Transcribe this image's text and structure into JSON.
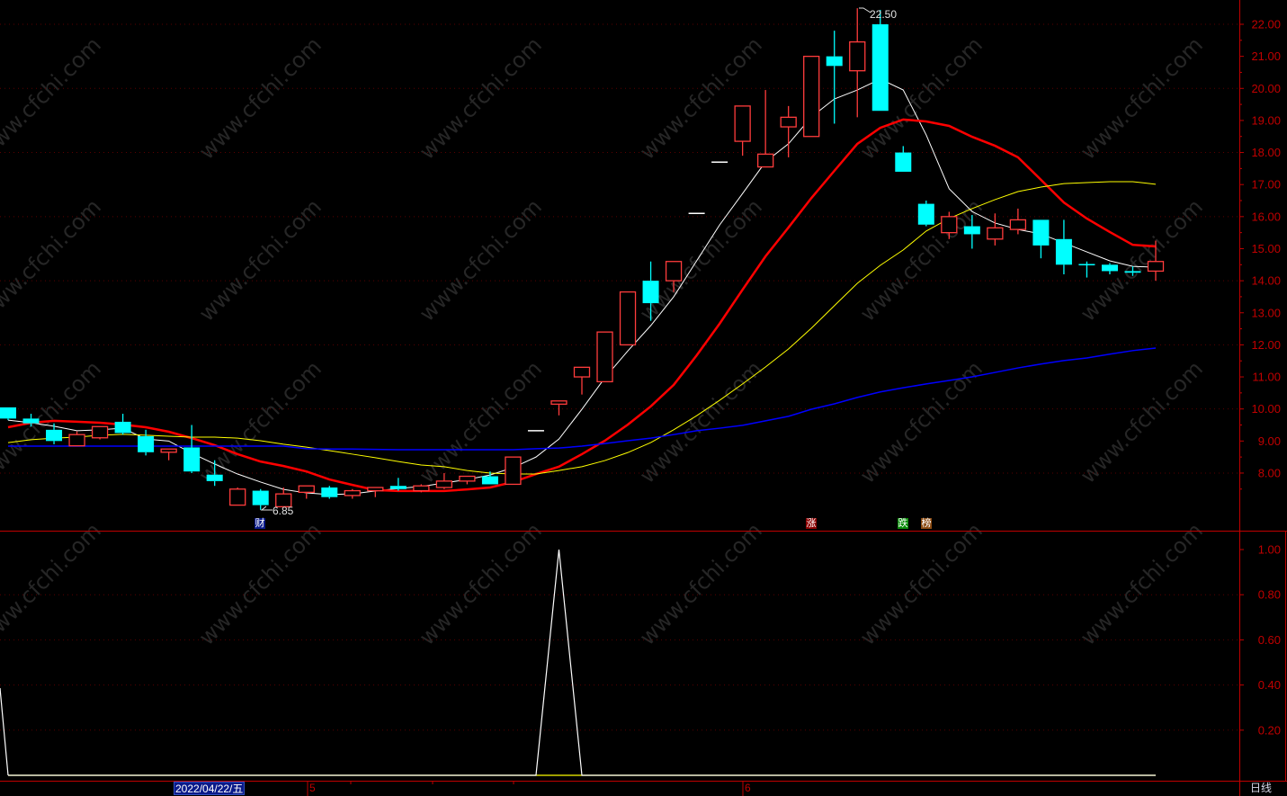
{
  "watermark": "www.cfchi.com",
  "colors": {
    "up": "#ff3c3c",
    "down": "#00ffff",
    "flat": "#ffffff",
    "ma_white": "#ffffff",
    "ma_red": "#ff0000",
    "ma_yellow": "#ffff00",
    "ma_blue": "#0000ff",
    "axis": "#c00000",
    "grid": "#5a0000"
  },
  "markers": [
    {
      "label": "财",
      "bg": "#0a1a8a"
    },
    {
      "label": "涨",
      "bg": "#8b0000"
    },
    {
      "label": "跌",
      "bg": "#0a8a0a"
    },
    {
      "label": "榜",
      "bg": "#8b4a10"
    }
  ],
  "x_axis": {
    "selected_date": "2022/04/22/五",
    "months": [
      "5",
      "6"
    ]
  },
  "period_label": "日线",
  "chart_data": [
    {
      "type": "candlestick",
      "ylim": [
        6.5,
        22.8
      ],
      "y_ticks": [
        "22.00",
        "21.00",
        "20.00",
        "19.00",
        "18.00",
        "17.00",
        "16.00",
        "15.00",
        "14.00",
        "13.00",
        "12.00",
        "11.00",
        "10.00",
        "9.00",
        "8.00"
      ],
      "grid": true,
      "fields": [
        "open",
        "close",
        "high",
        "low"
      ],
      "candles": [
        [
          10.05,
          9.7,
          10.05,
          9.65
        ],
        [
          9.7,
          9.55,
          9.85,
          9.45
        ],
        [
          9.35,
          9.0,
          9.55,
          8.9
        ],
        [
          8.85,
          9.2,
          9.3,
          8.85
        ],
        [
          9.1,
          9.45,
          9.45,
          9.05
        ],
        [
          9.6,
          9.25,
          9.85,
          9.2
        ],
        [
          9.15,
          8.65,
          9.35,
          8.55
        ],
        [
          8.65,
          8.75,
          8.75,
          8.4
        ],
        [
          8.8,
          8.05,
          9.5,
          8.0
        ],
        [
          7.95,
          7.75,
          8.4,
          7.6
        ],
        [
          7.0,
          7.5,
          7.55,
          7.0
        ],
        [
          7.45,
          7.0,
          7.5,
          6.85
        ],
        [
          6.95,
          7.35,
          7.55,
          6.95
        ],
        [
          7.4,
          7.6,
          7.6,
          7.2
        ],
        [
          7.55,
          7.25,
          7.6,
          7.2
        ],
        [
          7.3,
          7.45,
          7.5,
          7.2
        ],
        [
          7.45,
          7.55,
          7.55,
          7.25
        ],
        [
          7.6,
          7.5,
          7.85,
          7.45
        ],
        [
          7.45,
          7.6,
          7.65,
          7.4
        ],
        [
          7.55,
          7.75,
          8.0,
          7.5
        ],
        [
          7.75,
          7.9,
          7.9,
          7.65
        ],
        [
          7.9,
          7.65,
          8.05,
          7.65
        ],
        [
          7.65,
          8.5,
          8.5,
          7.65
        ],
        [
          9.32,
          9.32,
          9.32,
          9.32
        ],
        [
          10.15,
          10.25,
          10.25,
          9.8
        ],
        [
          11.0,
          11.3,
          11.3,
          10.45
        ],
        [
          10.85,
          12.4,
          12.4,
          10.85
        ],
        [
          12.0,
          13.65,
          13.65,
          12.0
        ],
        [
          14.0,
          13.3,
          14.6,
          12.75
        ],
        [
          14.0,
          14.6,
          14.6,
          13.65
        ],
        [
          16.1,
          16.1,
          16.1,
          16.1
        ],
        [
          17.7,
          17.7,
          17.7,
          17.7
        ],
        [
          18.35,
          19.45,
          19.45,
          17.9
        ],
        [
          17.55,
          17.95,
          19.95,
          17.55
        ],
        [
          18.8,
          19.1,
          19.45,
          17.85
        ],
        [
          18.5,
          21.0,
          21.0,
          18.5
        ],
        [
          21.0,
          20.7,
          21.8,
          18.9
        ],
        [
          20.55,
          21.45,
          22.5,
          19.1
        ],
        [
          22.0,
          19.3,
          22.45,
          19.3
        ],
        [
          18.0,
          17.4,
          18.2,
          17.4
        ],
        [
          16.4,
          15.75,
          16.5,
          15.7
        ],
        [
          15.5,
          16.0,
          16.15,
          15.3
        ],
        [
          15.7,
          15.45,
          16.05,
          15.0
        ],
        [
          15.3,
          15.65,
          16.1,
          15.1
        ],
        [
          15.6,
          15.9,
          16.25,
          15.45
        ],
        [
          15.9,
          15.1,
          15.9,
          14.7
        ],
        [
          15.3,
          14.5,
          15.9,
          14.2
        ],
        [
          14.5,
          14.5,
          14.6,
          14.1
        ],
        [
          14.5,
          14.3,
          14.55,
          14.2
        ],
        [
          14.3,
          14.25,
          14.45,
          14.15
        ],
        [
          14.3,
          14.6,
          15.25,
          14.0
        ]
      ],
      "moving_averages": [
        {
          "color": "#ffffff",
          "values": [
            9.65,
            9.57,
            9.46,
            9.32,
            9.35,
            9.4,
            9.06,
            9.0,
            8.62,
            8.28,
            7.97,
            7.72,
            7.49,
            7.38,
            7.33,
            7.35,
            7.44,
            7.52,
            7.58,
            7.69,
            7.8,
            7.94,
            8.17,
            8.5,
            9.06,
            9.99,
            10.97,
            11.81,
            12.6,
            13.5,
            14.62,
            15.74,
            16.72,
            17.71,
            18.27,
            19.11,
            19.67,
            19.95,
            20.29,
            19.95,
            18.55,
            16.87,
            16.16,
            15.8,
            15.6,
            15.46,
            15.18,
            14.9,
            14.62,
            14.45,
            14.42
          ]
        },
        {
          "color": "#ff0000",
          "values": [
            9.43,
            9.57,
            9.63,
            9.6,
            9.57,
            9.51,
            9.43,
            9.29,
            9.09,
            8.87,
            8.59,
            8.36,
            8.22,
            8.05,
            7.8,
            7.63,
            7.47,
            7.44,
            7.44,
            7.44,
            7.49,
            7.55,
            7.72,
            7.97,
            8.2,
            8.59,
            9.01,
            9.51,
            10.08,
            10.75,
            11.67,
            12.66,
            13.72,
            14.76,
            15.66,
            16.58,
            17.43,
            18.27,
            18.77,
            19.03,
            18.97,
            18.83,
            18.49,
            18.21,
            17.85,
            17.15,
            16.44,
            15.94,
            15.52,
            15.12,
            15.07
          ]
        },
        {
          "color": "#ffff00",
          "values": [
            8.95,
            9.04,
            9.09,
            9.12,
            9.18,
            9.21,
            9.18,
            9.15,
            9.12,
            9.12,
            9.09,
            9.01,
            8.9,
            8.81,
            8.7,
            8.59,
            8.48,
            8.36,
            8.25,
            8.2,
            8.08,
            8.0,
            7.97,
            7.97,
            8.08,
            8.2,
            8.39,
            8.64,
            8.95,
            9.35,
            9.79,
            10.27,
            10.78,
            11.31,
            11.87,
            12.52,
            13.22,
            13.92,
            14.48,
            14.96,
            15.55,
            15.94,
            16.25,
            16.53,
            16.78,
            16.92,
            17.03,
            17.06,
            17.09,
            17.09,
            17.01
          ]
        },
        {
          "color": "#0000ff",
          "values": [
            8.84,
            8.84,
            8.84,
            8.84,
            8.84,
            8.84,
            8.84,
            8.84,
            8.84,
            8.84,
            8.84,
            8.84,
            8.84,
            8.76,
            8.75,
            8.75,
            8.74,
            8.73,
            8.73,
            8.73,
            8.73,
            8.73,
            8.73,
            8.76,
            8.78,
            8.84,
            8.92,
            9.01,
            9.09,
            9.2,
            9.32,
            9.4,
            9.49,
            9.63,
            9.77,
            9.99,
            10.16,
            10.36,
            10.53,
            10.66,
            10.78,
            10.89,
            11.0,
            11.14,
            11.28,
            11.4,
            11.51,
            11.59,
            11.71,
            11.82,
            11.9
          ]
        }
      ],
      "annotations": {
        "high_label": "22.50",
        "low_label": "6.85"
      }
    },
    {
      "type": "line",
      "ylim": [
        0,
        1.1
      ],
      "y_ticks": [
        "1.00",
        "0.80",
        "0.60",
        "0.40",
        "0.20"
      ],
      "grid": true,
      "series": [
        {
          "color": "#ffffff",
          "values": [
            0,
            0,
            0,
            0,
            0,
            0,
            0,
            0,
            0,
            0,
            0,
            0,
            0,
            0,
            0,
            0,
            0,
            0,
            0,
            0,
            0,
            0,
            0,
            0,
            1,
            0,
            0,
            0,
            0,
            0,
            0,
            0,
            0,
            0,
            0,
            0,
            0,
            0,
            0,
            0,
            0,
            0,
            0,
            0,
            0,
            0,
            0,
            0,
            0,
            0,
            0
          ]
        },
        {
          "color": "#ffff00",
          "values": [
            0,
            0,
            0,
            0,
            0,
            0,
            0,
            0,
            0,
            0,
            0,
            0,
            0,
            0,
            0,
            0,
            0,
            0,
            0,
            0,
            0,
            0,
            0,
            0,
            0,
            0,
            0,
            0,
            0,
            0,
            0,
            0,
            0,
            0,
            0,
            0,
            0,
            0,
            0,
            0,
            0,
            0,
            0,
            0,
            0,
            0,
            0,
            0,
            0,
            0,
            0
          ]
        }
      ]
    }
  ]
}
